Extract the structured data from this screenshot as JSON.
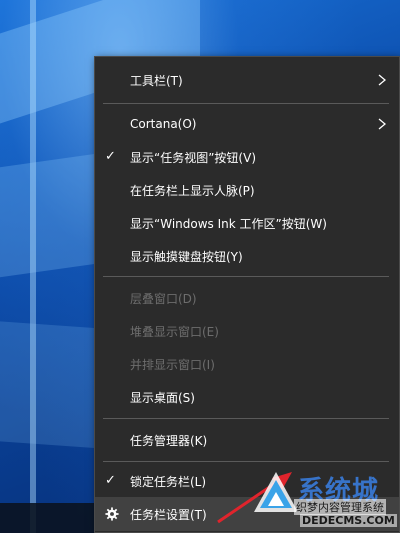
{
  "menu": {
    "items": [
      {
        "label": "工具栏(T)",
        "checked": false,
        "disabled": false,
        "submenu": true
      },
      {
        "label": "Cortana(O)",
        "checked": false,
        "disabled": false,
        "submenu": true
      },
      {
        "label": "显示“任务视图”按钮(V)",
        "checked": true,
        "disabled": false,
        "submenu": false
      },
      {
        "label": "在任务栏上显示人脉(P)",
        "checked": false,
        "disabled": false,
        "submenu": false
      },
      {
        "label": "显示“Windows Ink 工作区”按钮(W)",
        "checked": false,
        "disabled": false,
        "submenu": false
      },
      {
        "label": "显示触摸键盘按钮(Y)",
        "checked": false,
        "disabled": false,
        "submenu": false
      },
      {
        "label": "层叠窗口(D)",
        "checked": false,
        "disabled": true,
        "submenu": false
      },
      {
        "label": "堆叠显示窗口(E)",
        "checked": false,
        "disabled": true,
        "submenu": false
      },
      {
        "label": "并排显示窗口(I)",
        "checked": false,
        "disabled": true,
        "submenu": false
      },
      {
        "label": "显示桌面(S)",
        "checked": false,
        "disabled": false,
        "submenu": false
      },
      {
        "label": "任务管理器(K)",
        "checked": false,
        "disabled": false,
        "submenu": false
      },
      {
        "label": "锁定任务栏(L)",
        "checked": true,
        "disabled": false,
        "submenu": false
      },
      {
        "label": "任务栏设置(T)",
        "checked": false,
        "disabled": false,
        "submenu": false,
        "icon": "gear-icon",
        "highlighted": true
      }
    ]
  },
  "watermark": {
    "brand": "系统城",
    "subtitle": "织梦内容管理系统",
    "url": "DEDECMS.COM"
  },
  "colors": {
    "menu_bg": "#2b2b2b",
    "menu_text": "#ffffff",
    "disabled_text": "#6d6d6d",
    "arrow": "#e0242c"
  }
}
